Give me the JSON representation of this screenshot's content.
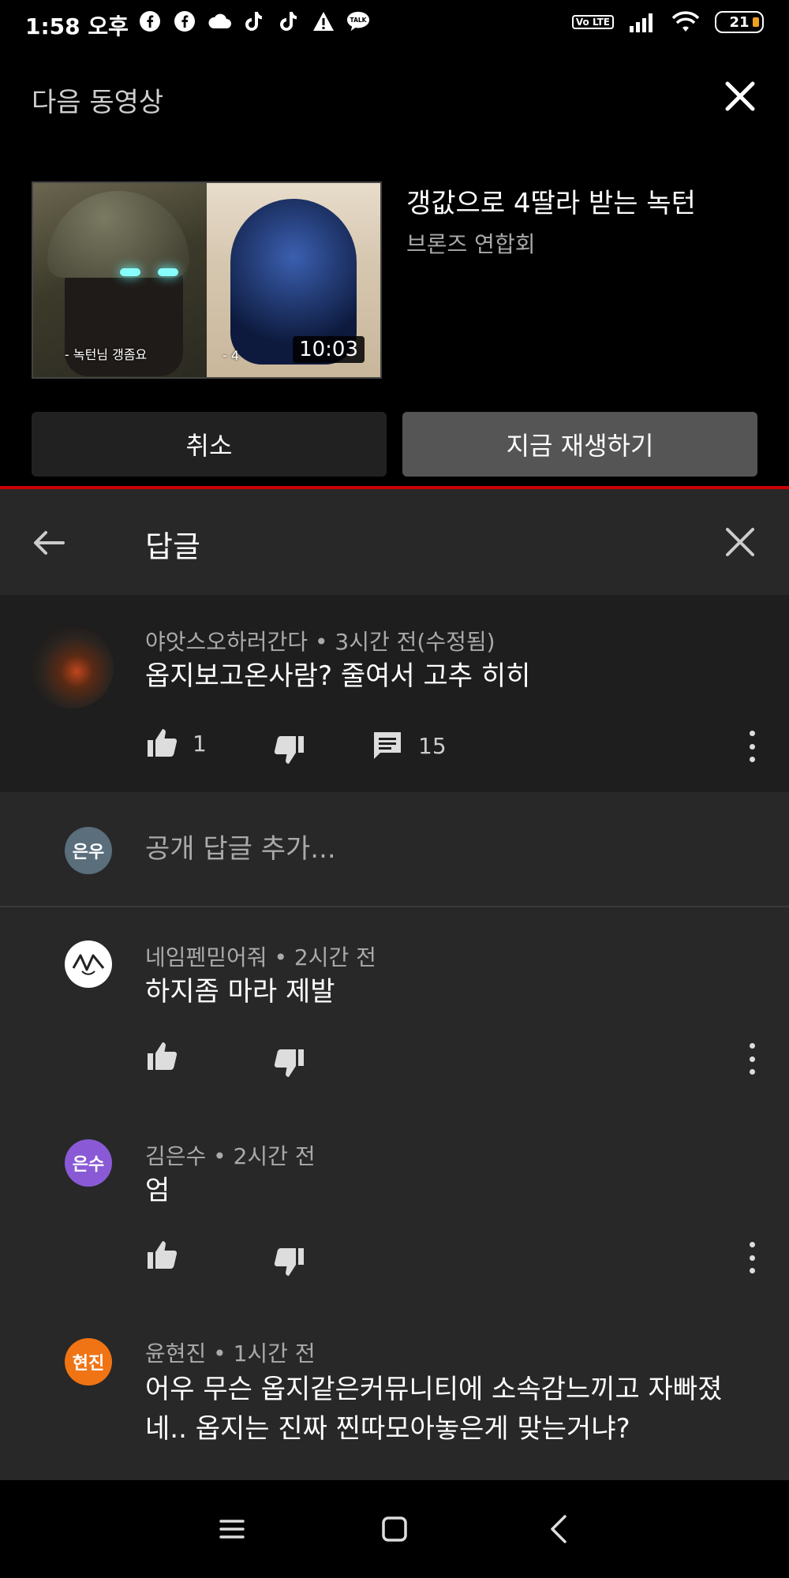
{
  "status_bar": {
    "time": "1:58 오후",
    "battery": "21",
    "volte": "Vo LTE",
    "icons": [
      "facebook-icon",
      "facebook-icon",
      "cloud-icon",
      "tiktok-icon",
      "tiktok-icon",
      "warning-icon",
      "talk-icon"
    ],
    "talk_label": "TALK"
  },
  "next_video": {
    "header": "다음 동영상",
    "title": "갱값으로 4딸라 받는 녹턴",
    "channel": "브론즈 연합회",
    "duration": "10:03",
    "thumb_caption_left": "- 녹턴님 갱좀요",
    "thumb_caption_right": "- 4",
    "cancel_label": "취소",
    "play_label": "지금 재생하기"
  },
  "replies": {
    "title": "답글",
    "parent": {
      "author": "야앗스오하러간다",
      "time": "3시간 전(수정됨)",
      "meta": "야앗스오하러간다 • 3시간 전(수정됨)",
      "text": "옵지보고온사람? 줄여서 고추 히히",
      "likes": "1",
      "reply_count": "15"
    },
    "add_reply": {
      "avatar_text": "은우",
      "placeholder": "공개 답글 추가..."
    },
    "items": [
      {
        "meta": "네임펜믿어줘 • 2시간 전",
        "text": "하지좀 마라 제발",
        "avatar_text": ""
      },
      {
        "meta": "김은수 • 2시간 전",
        "text": "엄",
        "avatar_text": "은수"
      },
      {
        "meta": "윤현진 • 1시간 전",
        "text_line1": "어우 무슨 옵지같은커뮤니티에 소속감느끼고 자빠졌",
        "text_line2": "네.. 옵지는 진짜 찐따모아놓은게 맞는거냐?",
        "avatar_text": "현진"
      }
    ]
  },
  "colors": {
    "background": "#000000",
    "panel": "#282828",
    "parent_comment_bg": "#1e1e1e",
    "progress_red": "#cc0000",
    "avatar_eunwoo": "#5a6e7c",
    "avatar_eunsu": "#8a5ad6",
    "avatar_hyeonjin": "#f07414"
  }
}
